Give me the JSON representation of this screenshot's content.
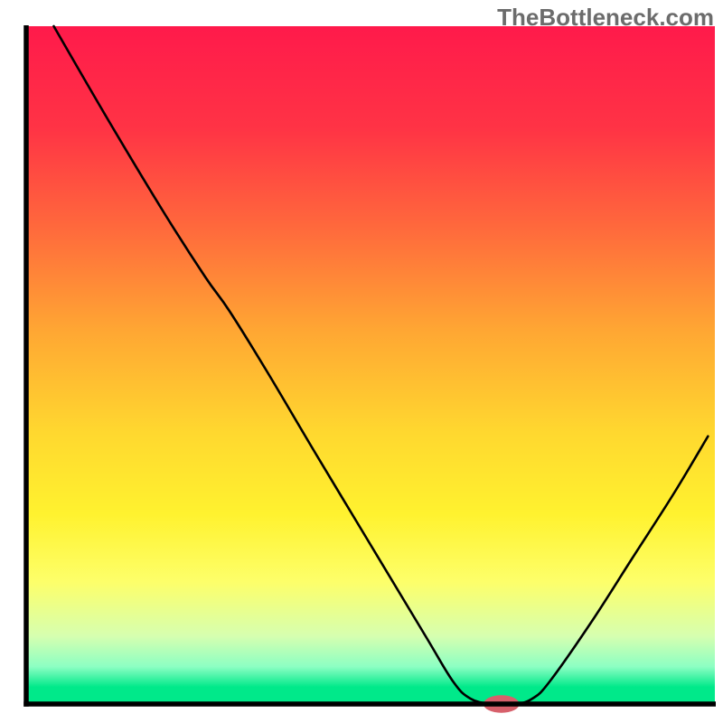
{
  "watermark": "TheBottleneck.com",
  "chart_data": {
    "type": "line",
    "title": "",
    "xlabel": "",
    "ylabel": "",
    "xlim": [
      0,
      100
    ],
    "ylim": [
      0,
      100
    ],
    "gradient_stops": [
      {
        "offset": 0.0,
        "color": "#ff1a4b"
      },
      {
        "offset": 0.15,
        "color": "#ff3345"
      },
      {
        "offset": 0.3,
        "color": "#ff6a3c"
      },
      {
        "offset": 0.45,
        "color": "#ffa733"
      },
      {
        "offset": 0.6,
        "color": "#ffd82f"
      },
      {
        "offset": 0.72,
        "color": "#fff22f"
      },
      {
        "offset": 0.82,
        "color": "#fdff6a"
      },
      {
        "offset": 0.9,
        "color": "#d6ffb0"
      },
      {
        "offset": 0.945,
        "color": "#8cffc3"
      },
      {
        "offset": 0.975,
        "color": "#00e98a"
      },
      {
        "offset": 1.0,
        "color": "#00e98a"
      }
    ],
    "curve": {
      "comment": "x in [0,100], y bottleneck percentage (0 = optimal/green, 100 = worst/red)",
      "points": [
        {
          "x": 4.0,
          "y": 100.0
        },
        {
          "x": 12.0,
          "y": 86.0
        },
        {
          "x": 20.0,
          "y": 72.5
        },
        {
          "x": 26.0,
          "y": 63.0
        },
        {
          "x": 29.5,
          "y": 58.0
        },
        {
          "x": 35.0,
          "y": 49.0
        },
        {
          "x": 42.0,
          "y": 37.0
        },
        {
          "x": 50.0,
          "y": 23.5
        },
        {
          "x": 58.0,
          "y": 10.0
        },
        {
          "x": 62.0,
          "y": 3.3
        },
        {
          "x": 64.5,
          "y": 0.8
        },
        {
          "x": 67.5,
          "y": 0.0
        },
        {
          "x": 71.0,
          "y": 0.0
        },
        {
          "x": 73.5,
          "y": 0.8
        },
        {
          "x": 76.0,
          "y": 3.3
        },
        {
          "x": 82.0,
          "y": 12.0
        },
        {
          "x": 88.0,
          "y": 21.5
        },
        {
          "x": 94.0,
          "y": 31.0
        },
        {
          "x": 99.0,
          "y": 39.5
        }
      ]
    },
    "marker": {
      "x": 69.0,
      "y": 0.0,
      "rx": 2.6,
      "ry": 1.3,
      "color": "#d7606b"
    },
    "axes": {
      "left": {
        "x": 3.5,
        "y0": 3.5,
        "y1": 97.5
      },
      "bottom": {
        "y": 97.5,
        "x0": 3.5,
        "x1": 99.0
      }
    }
  }
}
